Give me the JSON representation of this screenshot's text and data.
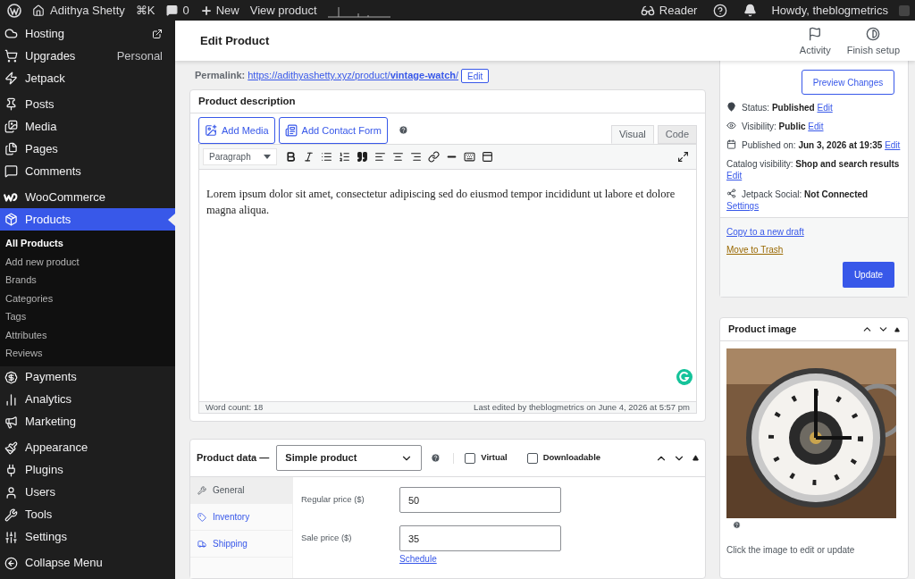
{
  "admin_bar": {
    "site": "Adithya Shetty",
    "shortcut": "⌘K",
    "comments": "0",
    "new": "New",
    "view": "View product",
    "reader": "Reader",
    "greeting": "Howdy, theblogmetrics"
  },
  "sidebar": {
    "groups": [
      [
        {
          "label": "Hosting",
          "selected": false
        },
        {
          "label": "Upgrades",
          "note": "Personal",
          "selected": false
        },
        {
          "label": "Jetpack",
          "selected": false
        }
      ],
      [
        {
          "label": "Posts",
          "selected": false
        },
        {
          "label": "Media",
          "selected": false
        },
        {
          "label": "Pages",
          "selected": false
        },
        {
          "label": "Comments",
          "selected": false
        }
      ],
      [
        {
          "label": "WooCommerce",
          "selected": false
        },
        {
          "label": "Products",
          "selected": true,
          "children": [
            {
              "label": "All Products",
              "selected": true
            },
            {
              "label": "Add new product",
              "selected": false
            },
            {
              "label": "Brands",
              "selected": false
            },
            {
              "label": "Categories",
              "selected": false
            },
            {
              "label": "Tags",
              "selected": false
            },
            {
              "label": "Attributes",
              "selected": false
            },
            {
              "label": "Reviews",
              "selected": false
            }
          ]
        },
        {
          "label": "Payments",
          "selected": false
        },
        {
          "label": "Analytics",
          "selected": false
        },
        {
          "label": "Marketing",
          "selected": false
        }
      ],
      [
        {
          "label": "Appearance",
          "selected": false
        },
        {
          "label": "Plugins",
          "selected": false
        },
        {
          "label": "Users",
          "selected": false
        },
        {
          "label": "Tools",
          "selected": false
        },
        {
          "label": "Settings",
          "selected": false
        }
      ],
      [
        {
          "label": "Collapse Menu",
          "selected": false
        }
      ]
    ]
  },
  "header": {
    "title": "Edit Product",
    "actions": [
      {
        "label": "Activity"
      },
      {
        "label": "Finish setup"
      }
    ]
  },
  "permalink": {
    "label": "Permalink:",
    "url": "https://adithyashetty.xyz/product/**vintage-watch**/",
    "button": "Edit"
  },
  "description": {
    "title": "Product description",
    "buttons": [
      "Add Media",
      "Add Contact Form"
    ],
    "tabs": [
      {
        "label": "Visual",
        "selected": true
      },
      {
        "label": "Code",
        "selected": false
      }
    ],
    "format": "Paragraph",
    "body": "Lorem ipsum dolor sit amet, consectetur adipiscing sed do eiusmod tempor incididunt ut labore et dolore magna aliqua.",
    "word_count": "Word count: 18",
    "last_edited": "Last edited by theblogmetrics on June 4, 2026 at 5:57 pm"
  },
  "product_data": {
    "title": "Product data —",
    "type": "Simple product",
    "options": [
      {
        "label": "Virtual",
        "checked": false
      },
      {
        "label": "Downloadable",
        "checked": false
      }
    ],
    "tabs": [
      {
        "label": "General",
        "selected": true
      },
      {
        "label": "Inventory",
        "selected": false
      },
      {
        "label": "Shipping",
        "selected": false
      }
    ],
    "fields": [
      {
        "label": "Regular price ($)",
        "value": "50"
      },
      {
        "label": "Sale price ($)",
        "value": "35",
        "link": "Schedule"
      }
    ]
  },
  "publish": {
    "preview": "Preview Changes",
    "rows": [
      {
        "label": "Status:",
        "value": "Published",
        "link": "Edit"
      },
      {
        "label": "Visibility:",
        "value": "Public",
        "link": "Edit"
      },
      {
        "label": "Published on:",
        "value": "Jun 3, 2026 at 19:35",
        "link": "Edit"
      },
      {
        "label": "Catalog visibility:",
        "value": "Shop and search results",
        "link": "Edit"
      },
      {
        "label": "Jetpack Social:",
        "value": "Not Connected",
        "link": "Settings"
      }
    ],
    "copy": "Copy to a new draft",
    "trash": "Move to Trash",
    "update": "Update"
  },
  "product_image": {
    "title": "Product image",
    "caption": "Click the image to edit or update"
  }
}
